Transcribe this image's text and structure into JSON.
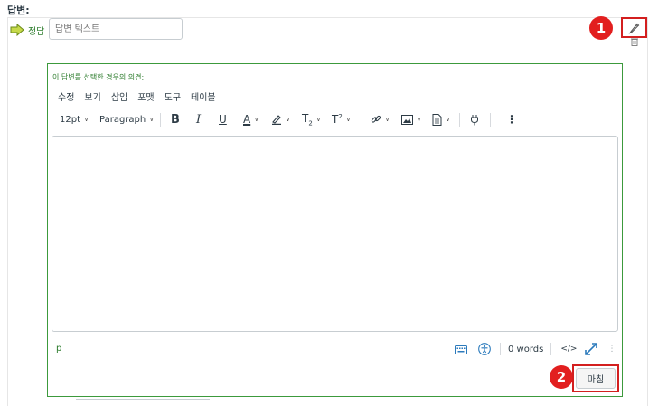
{
  "answers_label": "답변:",
  "answer": {
    "correct_label": "정답",
    "input_placeholder": "답변 텍스트"
  },
  "callouts": {
    "step1": "1",
    "step2": "2"
  },
  "editor": {
    "feedback_label": "이 답변를 선택한 경우의 의견:",
    "menu": [
      "수정",
      "보기",
      "삽입",
      "포맷",
      "도구",
      "테이블"
    ],
    "font_size": "12pt",
    "block_format": "Paragraph",
    "status_tag": "p",
    "word_count": "0 words",
    "html_toggle": "</>"
  },
  "done_button": "마침",
  "colors": {
    "accent_green": "#2c7c2c",
    "frame_green": "#3c9a3c",
    "callout_red": "#e21f1f"
  }
}
